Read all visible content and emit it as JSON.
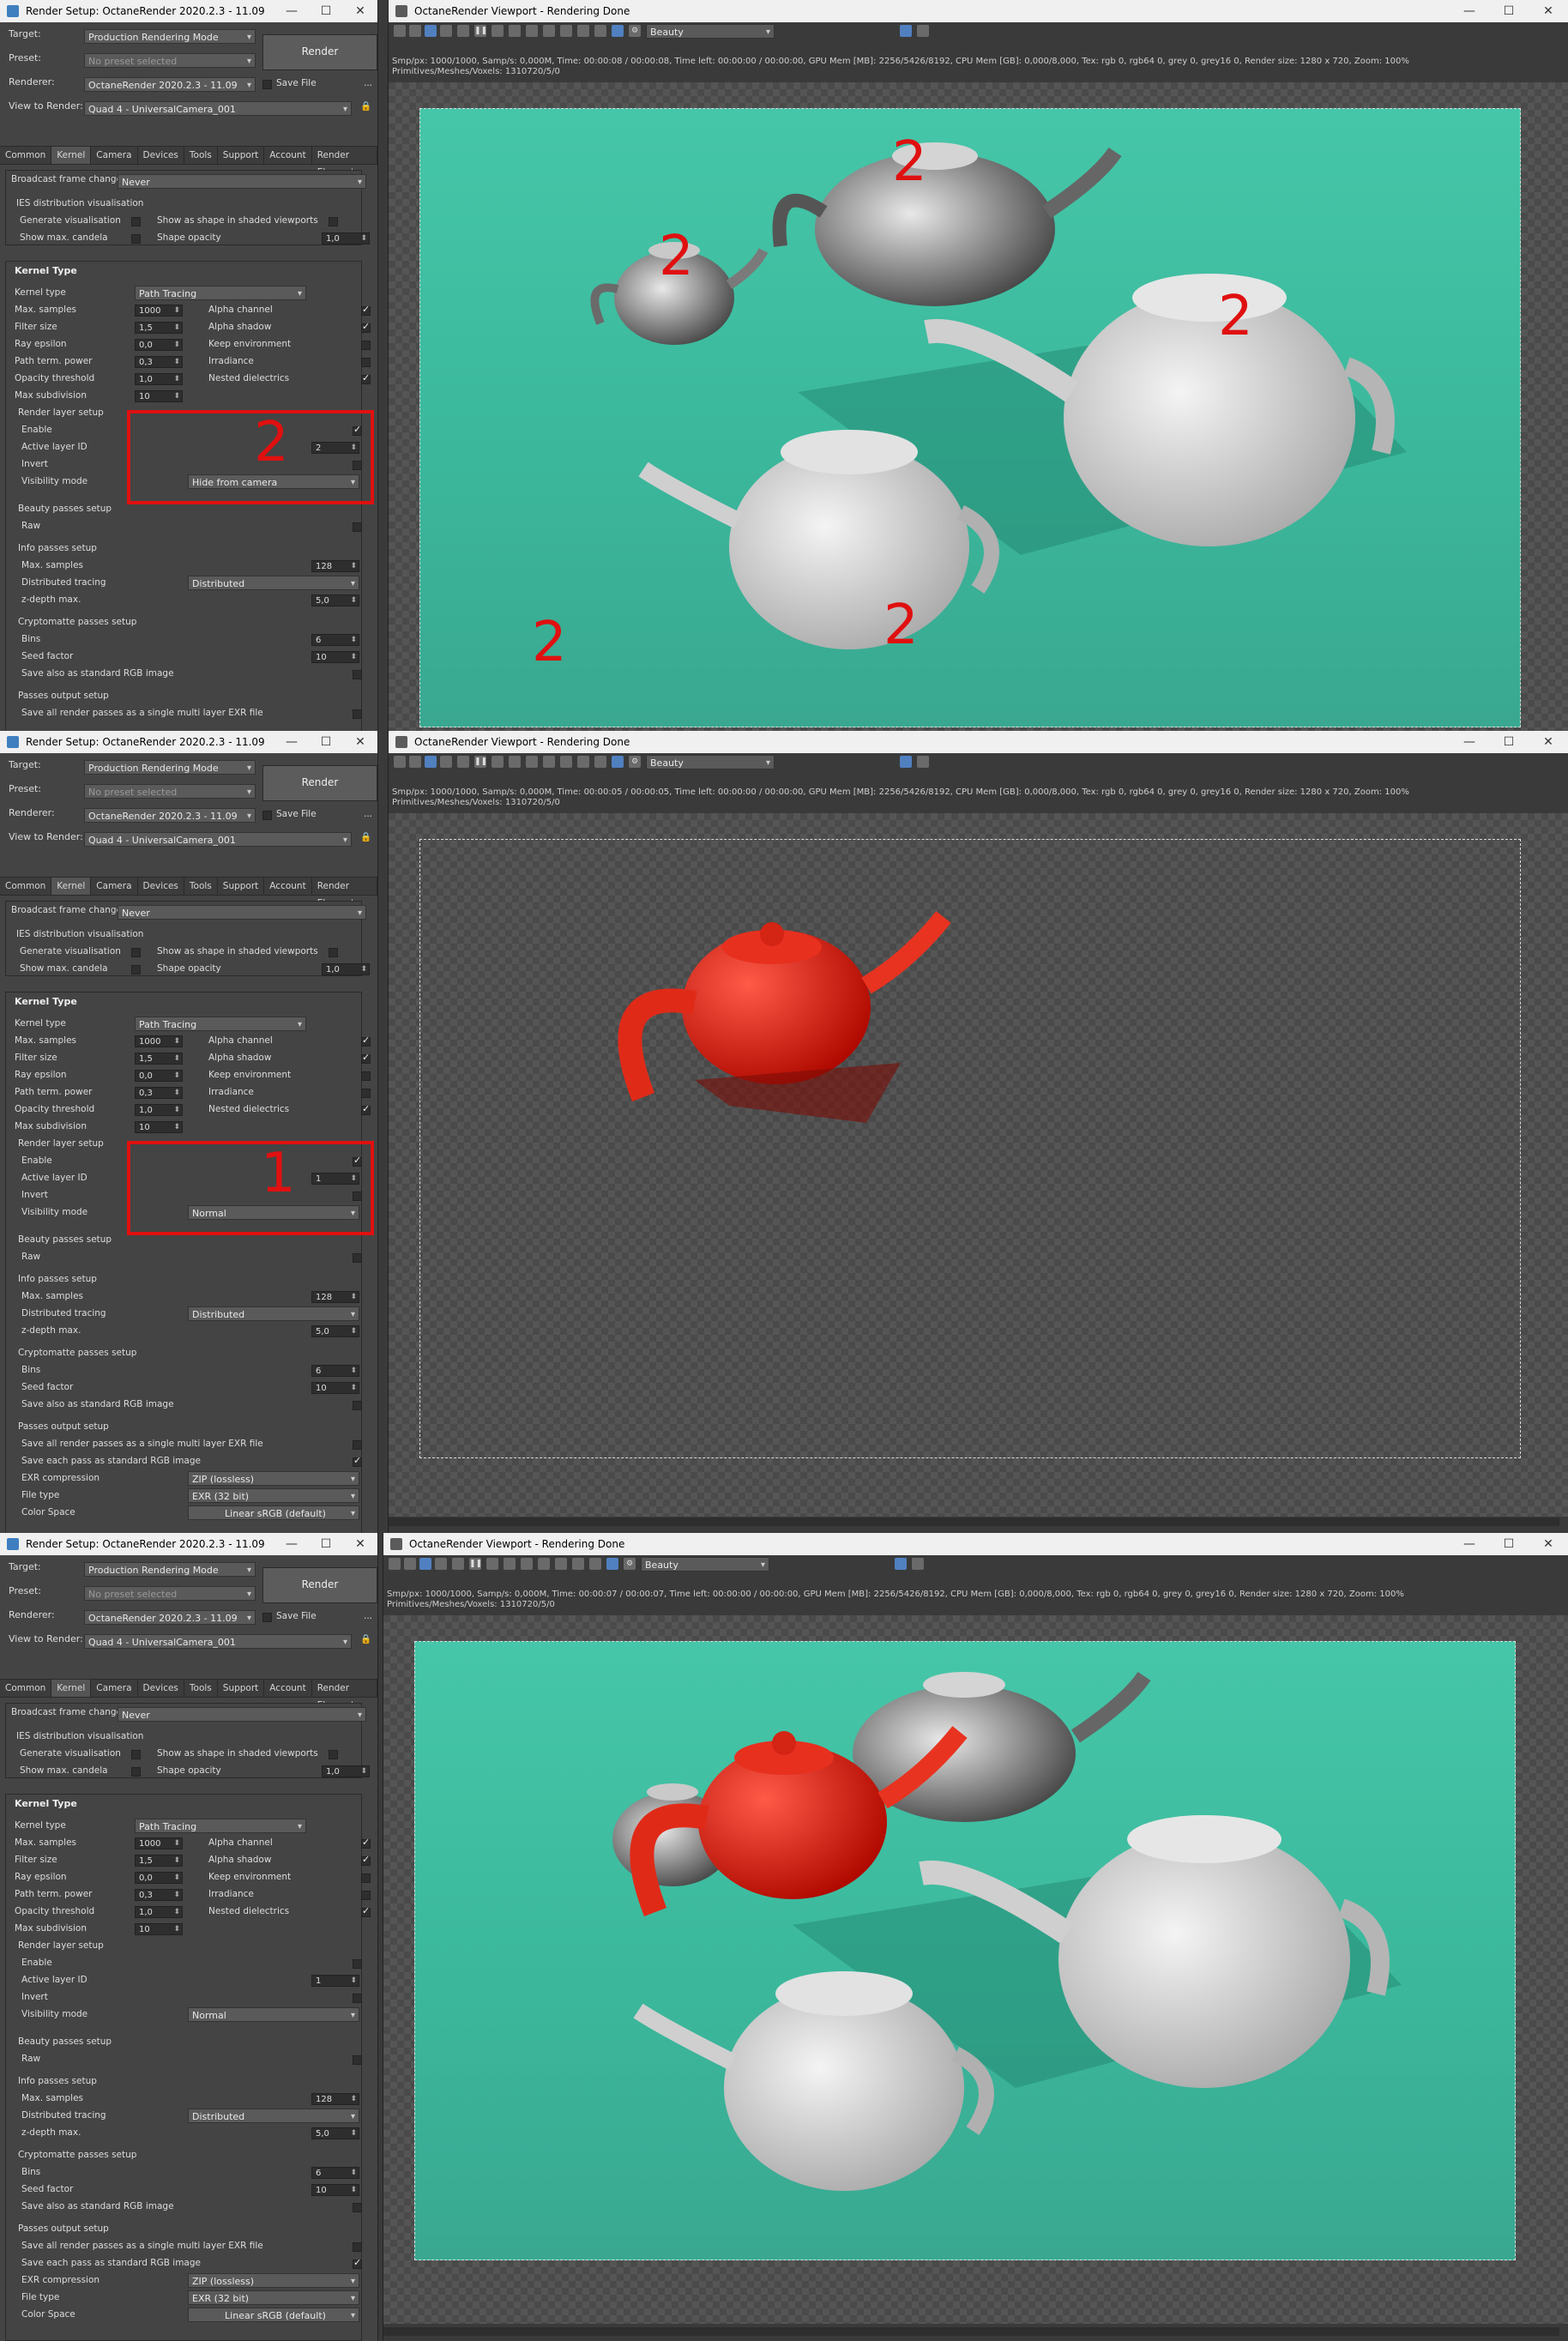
{
  "render_setup_title": "Render Setup: OctaneRender 2020.2.3 - 11.09",
  "viewport_title": "OctaneRender Viewport - Rendering Done",
  "win_min": "—",
  "win_max": "☐",
  "win_close": "✕",
  "labels": {
    "target": "Target:",
    "preset": "Preset:",
    "renderer": "Renderer:",
    "view_to_render": "View to Render:",
    "save_file": "Save File",
    "render_button": "Render",
    "more": "...",
    "broadcast": "Broadcast frame change",
    "ies_title": "IES distribution visualisation",
    "generate_vis": "Generate visualisation",
    "show_shape": "Show as shape in shaded viewports",
    "show_max_candela": "Show max. candela",
    "shape_opacity": "Shape opacity",
    "kernel_type_section": "Kernel Type",
    "kernel_type": "Kernel type",
    "max_samples": "Max. samples",
    "filter_size": "Filter size",
    "ray_epsilon": "Ray epsilon",
    "path_term_power": "Path term. power",
    "opacity_threshold": "Opacity threshold",
    "max_subdivision": "Max subdivision",
    "alpha_channel": "Alpha channel",
    "alpha_shadow": "Alpha shadow",
    "keep_environment": "Keep environment",
    "irradiance": "Irradiance",
    "nested_dielectrics": "Nested dielectrics",
    "render_layer_setup": "Render layer setup",
    "enable": "Enable",
    "active_layer_id": "Active layer ID",
    "invert": "Invert",
    "visibility_mode": "Visibility mode",
    "beauty_passes_setup": "Beauty passes setup",
    "raw": "Raw",
    "info_passes_setup": "Info passes setup",
    "distributed_tracing": "Distributed tracing",
    "z_depth_max": "z-depth max.",
    "cryptomatte_passes_setup": "Cryptomatte passes setup",
    "bins": "Bins",
    "seed_factor": "Seed factor",
    "save_also_rgb": "Save also as standard RGB image",
    "passes_output_setup": "Passes output setup",
    "save_all_multilayer": "Save all render passes as a single multi layer EXR file",
    "save_each_pass": "Save each pass as standard RGB image",
    "exr_compression": "EXR compression",
    "file_type": "File type",
    "color_space": "Color Space"
  },
  "values": {
    "target": "Production Rendering Mode",
    "preset": "No preset selected",
    "renderer": "OctaneRender 2020.2.3 - 11.09",
    "view": "Quad 4 - UniversalCamera_001",
    "broadcast": "Never",
    "shape_opacity": "1,0",
    "kernel_type": "Path Tracing",
    "max_samples": "1000",
    "filter_size": "1,5",
    "ray_epsilon": "0,0",
    "path_term_power": "0,3",
    "opacity_threshold": "1,0",
    "max_subdivision": "10",
    "info_max_samples": "128",
    "distributed": "Distributed",
    "z_depth": "5,0",
    "bins": "6",
    "seed_factor": "10",
    "exr_compression": "ZIP (lossless)",
    "file_type": "EXR (32 bit)",
    "color_space": "Linear sRGB (default)"
  },
  "tabs": [
    "Common",
    "Kernel",
    "Camera",
    "Devices",
    "Tools",
    "Support",
    "Account",
    "Render Elements"
  ],
  "viewport": {
    "pass_dropdown": "Beauty",
    "prims_line": "Primitives/Meshes/Voxels: 1310720/5/0"
  },
  "panels": [
    {
      "active_layer_id": "2",
      "visibility_mode": "Hide from camera",
      "status": "Smp/px: 1000/1000,  Samp/s: 0,000M,  Time: 00:00:08 / 00:00:08,  Time left: 00:00:00 / 00:00:00,  GPU Mem [MB]: 2256/5426/8192,  CPU Mem [GB]: 0,000/8,000,  Tex: rgb 0, rgb64 0, grey 0, grey16 0,  Render size: 1280 x 720,  Zoom: 100%",
      "annotation": "2"
    },
    {
      "active_layer_id": "1",
      "visibility_mode": "Normal",
      "status": "Smp/px: 1000/1000,  Samp/s: 0,000M,  Time: 00:00:05 / 00:00:05,  Time left: 00:00:00 / 00:00:00,  GPU Mem [MB]: 2256/5426/8192,  CPU Mem [GB]: 0,000/8,000,  Tex: rgb 0, rgb64 0, grey 0, grey16 0,  Render size: 1280 x 720,  Zoom: 100%",
      "annotation": "1"
    },
    {
      "active_layer_id": "1",
      "visibility_mode": "Normal",
      "status": "Smp/px: 1000/1000,  Samp/s: 0,000M,  Time: 00:00:07 / 00:00:07,  Time left: 00:00:00 / 00:00:00,  GPU Mem [MB]: 2256/5426/8192,  CPU Mem [GB]: 0,000/8,000,  Tex: rgb 0, rgb64 0, grey 0, grey16 0,  Render size: 1280 x 720,  Zoom: 100%",
      "annotation": ""
    }
  ]
}
